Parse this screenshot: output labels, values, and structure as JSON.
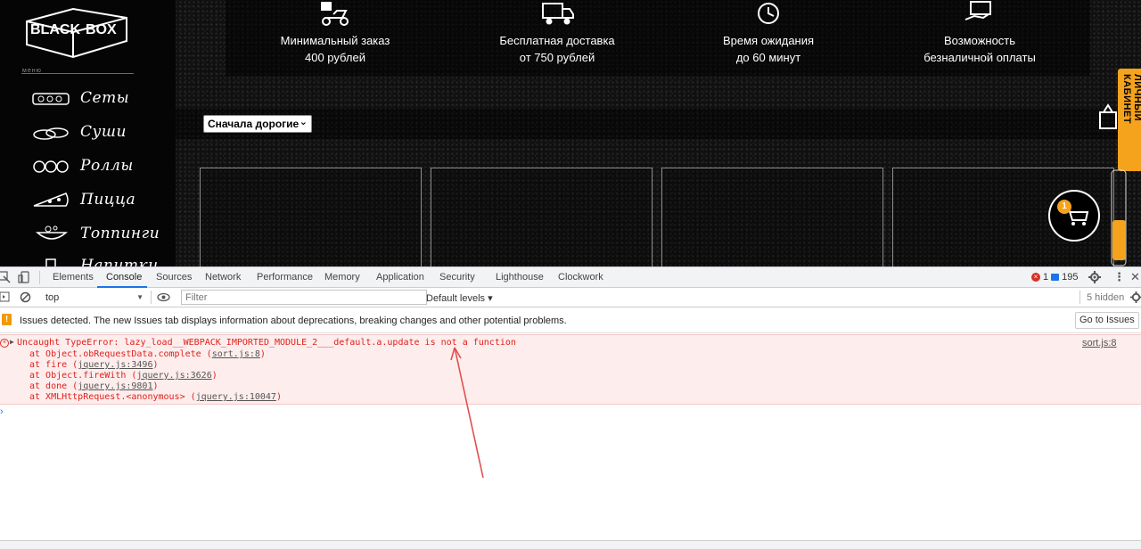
{
  "website": {
    "logo_text": "BLACK BOX",
    "menu_caption": "меню",
    "menu_items": [
      {
        "label": "Сеты",
        "icon": "sets-icon"
      },
      {
        "label": "Суши",
        "icon": "sushi-icon"
      },
      {
        "label": "Роллы",
        "icon": "rolls-icon"
      },
      {
        "label": "Пицца",
        "icon": "pizza-icon"
      },
      {
        "label": "Топпинги",
        "icon": "toppings-icon"
      },
      {
        "label": "Напитки",
        "icon": "drinks-icon"
      }
    ],
    "features": [
      {
        "line1": "Минимальный заказ",
        "line2": "400 рублей",
        "icon": "delivery-scooter-icon"
      },
      {
        "line1": "Бесплатная доставка",
        "line2": "от 750 рублей",
        "icon": "free-truck-icon"
      },
      {
        "line1": "Время ожидания",
        "line2": "до 60 минут",
        "icon": "timer-icon"
      },
      {
        "line1": "Возможность",
        "line2": "безналичной оплаты",
        "icon": "card-payment-icon"
      }
    ],
    "sort_select": {
      "selected": "Сначала дорогие",
      "chevron": "⌄"
    },
    "cabinet_tab": "ЛИЧНЫЙ КАБИНЕТ",
    "cart_count": "1",
    "accent_color": "#f5a21c"
  },
  "devtools": {
    "tabs": [
      "Elements",
      "Console",
      "Sources",
      "Network",
      "Performance",
      "Memory",
      "Application",
      "Security",
      "Lighthouse",
      "Clockwork"
    ],
    "active_tab": "Console",
    "error_count": "1",
    "message_count": "195",
    "toolbar": {
      "context": "top",
      "filter_placeholder": "Filter",
      "levels": "Default levels ▾",
      "hidden": "5 hidden"
    },
    "issues": {
      "text": "Issues detected. The new Issues tab displays information about deprecations, breaking changes and other potential problems.",
      "button": "Go to Issues"
    },
    "error": {
      "message": "Uncaught TypeError: lazy_load__WEBPACK_IMPORTED_MODULE_2___default.a.update is not a function",
      "source": "sort.js:8",
      "stack": [
        {
          "prefix": "at Object.obRequestData.complete (",
          "link": "sort.js:8",
          "suffix": ")"
        },
        {
          "prefix": "at fire (",
          "link": "jquery.js:3496",
          "suffix": ")"
        },
        {
          "prefix": "at Object.fireWith (",
          "link": "jquery.js:3626",
          "suffix": ")"
        },
        {
          "prefix": "at done (",
          "link": "jquery.js:9801",
          "suffix": ")"
        },
        {
          "prefix": "at XMLHttpRequest.<anonymous> (",
          "link": "jquery.js:10047",
          "suffix": ")"
        }
      ]
    },
    "prompt": "›",
    "error_color": "#e0201a",
    "annotation_arrow_color": "#e05050"
  }
}
